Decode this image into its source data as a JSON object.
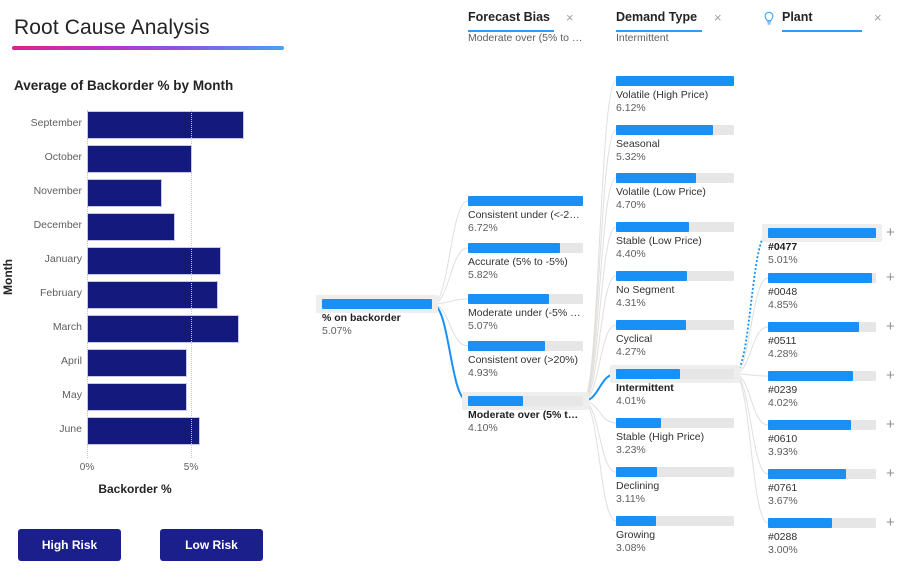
{
  "page": {
    "title": "Root Cause Analysis",
    "accent_gradient_from": "#e0218a",
    "accent_gradient_to": "#4aa3f0",
    "bar_color": "#14197d",
    "node_color": "#1890f5",
    "track_color": "#e6e6e6"
  },
  "buttons": {
    "high_risk": "High Risk",
    "low_risk": "Low Risk"
  },
  "chart_data": {
    "type": "bar",
    "orientation": "horizontal",
    "title": "Average of Backorder % by Month",
    "xlabel": "Backorder %",
    "ylabel": "Month",
    "categories": [
      "September",
      "October",
      "November",
      "December",
      "January",
      "February",
      "March",
      "April",
      "May",
      "June"
    ],
    "values": [
      7.55,
      5.05,
      3.61,
      4.23,
      6.44,
      6.3,
      7.31,
      4.81,
      4.81,
      5.43
    ],
    "xlim": [
      0,
      8.0
    ],
    "xticks": [
      0,
      5
    ],
    "xtick_labels": [
      "0%",
      "5%"
    ],
    "grid": true,
    "legend": "none"
  },
  "tree": {
    "columns": [
      {
        "id": "forecast-bias",
        "title": "Forecast Bias",
        "selected_value": "Moderate over (5% to …",
        "close_label": "×",
        "has_bulb": false
      },
      {
        "id": "demand-type",
        "title": "Demand Type",
        "selected_value": "Intermittent",
        "close_label": "×",
        "has_bulb": false
      },
      {
        "id": "plant",
        "title": "Plant",
        "selected_value": "",
        "close_label": "×",
        "has_bulb": true,
        "bulb_icon": "lightbulb-icon"
      }
    ],
    "root": {
      "label": "% on backorder",
      "value": "5.07%",
      "pct": 100,
      "selected": true
    },
    "forecast_bias_nodes": [
      {
        "label": "Consistent under (<-2…",
        "value": "6.72%",
        "pct": 100,
        "selected": false
      },
      {
        "label": "Accurate (5% to -5%)",
        "value": "5.82%",
        "pct": 80,
        "selected": false
      },
      {
        "label": "Moderate under (-5% …",
        "value": "5.07%",
        "pct": 70,
        "selected": false
      },
      {
        "label": "Consistent over (>20%)",
        "value": "4.93%",
        "pct": 67,
        "selected": false
      },
      {
        "label": "Moderate over (5% t…",
        "value": "4.10%",
        "pct": 48,
        "selected": true
      }
    ],
    "demand_type_nodes": [
      {
        "label": "Volatile (High Price)",
        "value": "6.12%",
        "pct": 100,
        "selected": false
      },
      {
        "label": "Seasonal",
        "value": "5.32%",
        "pct": 82,
        "selected": false
      },
      {
        "label": "Volatile (Low Price)",
        "value": "4.70%",
        "pct": 68,
        "selected": false
      },
      {
        "label": "Stable (Low Price)",
        "value": "4.40%",
        "pct": 62,
        "selected": false
      },
      {
        "label": "No Segment",
        "value": "4.31%",
        "pct": 60,
        "selected": false
      },
      {
        "label": "Cyclical",
        "value": "4.27%",
        "pct": 59,
        "selected": false
      },
      {
        "label": "Intermittent",
        "value": "4.01%",
        "pct": 54,
        "selected": true
      },
      {
        "label": "Stable (High Price)",
        "value": "3.23%",
        "pct": 38,
        "selected": false
      },
      {
        "label": "Declining",
        "value": "3.11%",
        "pct": 35,
        "selected": false
      },
      {
        "label": "Growing",
        "value": "3.08%",
        "pct": 34,
        "selected": false
      }
    ],
    "plant_nodes": [
      {
        "label": "#0477",
        "value": "5.01%",
        "pct": 100,
        "selected": true,
        "expand": "+"
      },
      {
        "label": "#0048",
        "value": "4.85%",
        "pct": 96,
        "selected": false,
        "expand": "+"
      },
      {
        "label": "#0511",
        "value": "4.28%",
        "pct": 84,
        "selected": false,
        "expand": "+"
      },
      {
        "label": "#0239",
        "value": "4.02%",
        "pct": 79,
        "selected": false,
        "expand": "+"
      },
      {
        "label": "#0610",
        "value": "3.93%",
        "pct": 77,
        "selected": false,
        "expand": "+"
      },
      {
        "label": "#0761",
        "value": "3.67%",
        "pct": 72,
        "selected": false,
        "expand": "+"
      },
      {
        "label": "#0288",
        "value": "3.00%",
        "pct": 59,
        "selected": false,
        "expand": "+"
      }
    ]
  }
}
